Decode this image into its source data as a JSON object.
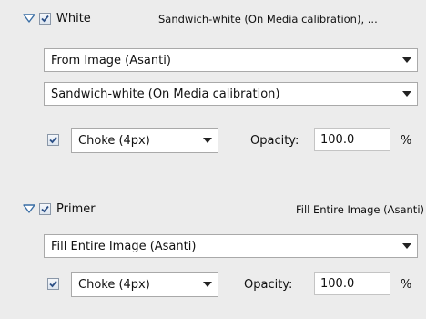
{
  "layers": [
    {
      "name": "White",
      "enabled": true,
      "summary": "Sandwich-white (On Media calibration), ...",
      "selects": [
        "From Image (Asanti)",
        "Sandwich-white (On Media calibration)"
      ],
      "choke_enabled": true,
      "choke": "Choke (4px)",
      "opacity_label": "Opacity:",
      "opacity": "100.0",
      "opacity_unit": "%"
    },
    {
      "name": "Primer",
      "enabled": true,
      "summary": "Fill Entire Image (Asanti)",
      "selects": [
        "Fill Entire Image (Asanti)"
      ],
      "choke_enabled": true,
      "choke": "Choke (4px)",
      "opacity_label": "Opacity:",
      "opacity": "100.0",
      "opacity_unit": "%"
    }
  ],
  "colors": {
    "panel_bg": "#ececec",
    "triangle": "#3a6ea5",
    "checkmark": "#2b4f86"
  },
  "icons": {
    "expand": "triangle-down-icon",
    "check": "checkmark-icon",
    "dropdown": "chevron-down-icon"
  }
}
